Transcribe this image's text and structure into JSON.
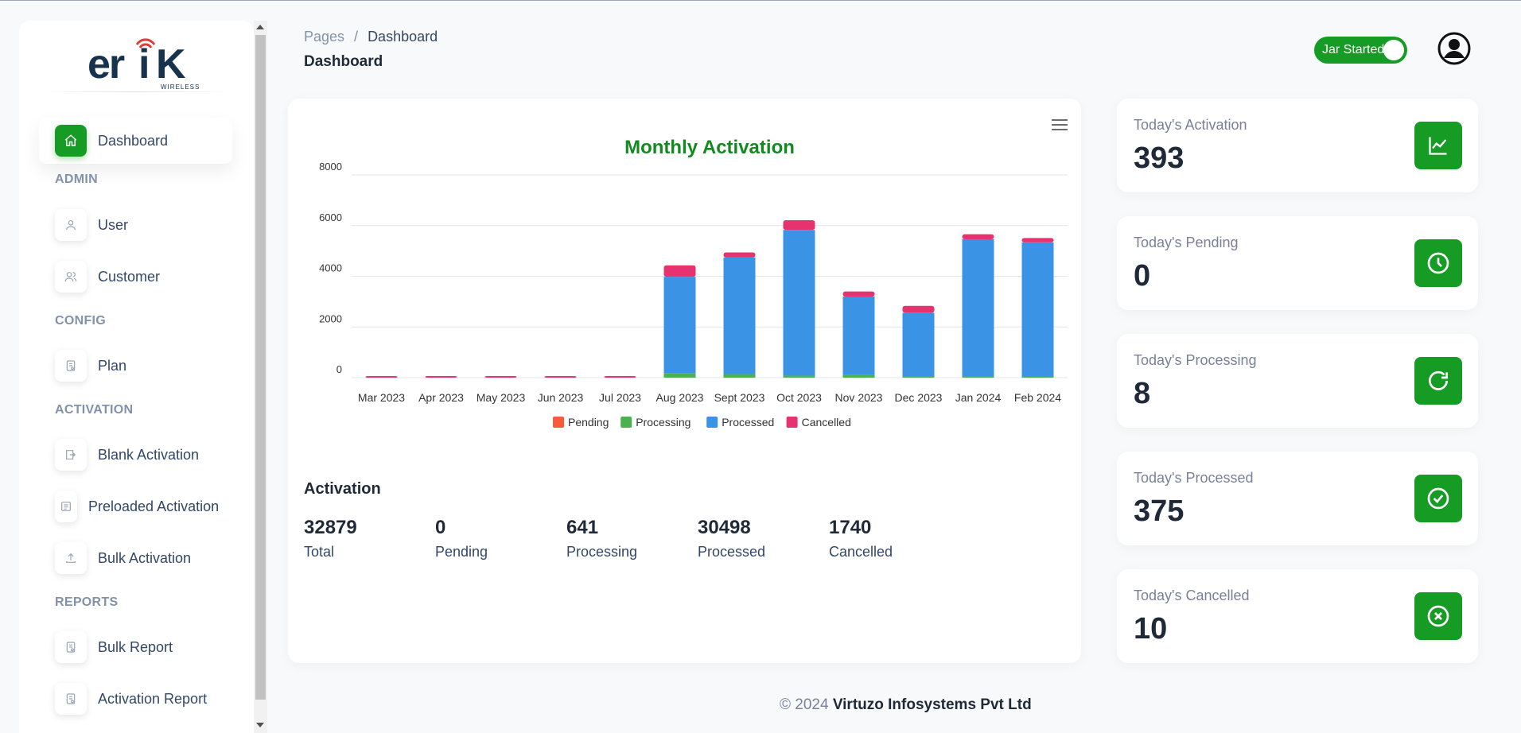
{
  "brand": {
    "logo_text": "erik",
    "logo_sub": "WIRELESS",
    "accent": "#169c25"
  },
  "sidebar": {
    "items": [
      {
        "label": "Dashboard",
        "icon": "home-icon",
        "active": true
      },
      {
        "label": "User",
        "icon": "user-icon"
      },
      {
        "label": "Customer",
        "icon": "users-icon"
      },
      {
        "label": "Plan",
        "icon": "document-icon"
      },
      {
        "label": "Blank Activation",
        "icon": "sim-icon"
      },
      {
        "label": "Preloaded Activation",
        "icon": "preloaded-icon"
      },
      {
        "label": "Bulk Activation",
        "icon": "upload-icon"
      },
      {
        "label": "Bulk Report",
        "icon": "report-icon"
      },
      {
        "label": "Activation Report",
        "icon": "report-icon"
      }
    ],
    "sections": {
      "admin": "ADMIN",
      "config": "CONFIG",
      "activation": "ACTIVATION",
      "reports": "REPORTS"
    }
  },
  "header": {
    "breadcrumb_root": "Pages",
    "breadcrumb_sep": "/",
    "breadcrumb_current": "Dashboard",
    "title": "Dashboard",
    "toggle_label": "Jar Started",
    "toggle_on": true
  },
  "chart_data": {
    "type": "bar",
    "stacked": true,
    "title": "Monthly Activation",
    "title_color": "#138a1f",
    "categories": [
      "Mar 2023",
      "Apr 2023",
      "May 2023",
      "Jun 2023",
      "Jul 2023",
      "Aug 2023",
      "Sept 2023",
      "Oct 2023",
      "Nov 2023",
      "Dec 2023",
      "Jan 2024",
      "Feb 2024"
    ],
    "series": [
      {
        "name": "Pending",
        "color": "#fa5a3c",
        "values": [
          0,
          0,
          0,
          0,
          0,
          0,
          0,
          0,
          0,
          0,
          0,
          0
        ]
      },
      {
        "name": "Processing",
        "color": "#4caf50",
        "values": [
          0,
          0,
          0,
          0,
          0,
          180,
          140,
          80,
          100,
          60,
          60,
          40
        ]
      },
      {
        "name": "Processed",
        "color": "#3b93e6",
        "values": [
          0,
          0,
          0,
          0,
          0,
          3800,
          4600,
          5750,
          3100,
          2500,
          5400,
          5300
        ]
      },
      {
        "name": "Cancelled",
        "color": "#e6336f",
        "values": [
          40,
          40,
          40,
          40,
          40,
          450,
          200,
          380,
          200,
          270,
          200,
          170
        ]
      }
    ],
    "ylim": [
      0,
      8000
    ],
    "yticks": [
      0,
      2000,
      4000,
      6000,
      8000
    ],
    "grid": true,
    "legend": "bottom"
  },
  "activation": {
    "title": "Activation",
    "stats": [
      {
        "value": "32879",
        "label": "Total"
      },
      {
        "value": "0",
        "label": "Pending"
      },
      {
        "value": "641",
        "label": "Processing"
      },
      {
        "value": "30498",
        "label": "Processed"
      },
      {
        "value": "1740",
        "label": "Cancelled"
      }
    ]
  },
  "today": [
    {
      "label": "Today's Activation",
      "value": "393",
      "icon": "chart-line-icon"
    },
    {
      "label": "Today's Pending",
      "value": "0",
      "icon": "clock-icon"
    },
    {
      "label": "Today's Processing",
      "value": "8",
      "icon": "refresh-icon"
    },
    {
      "label": "Today's Processed",
      "value": "375",
      "icon": "check-circle-icon"
    },
    {
      "label": "Today's Cancelled",
      "value": "10",
      "icon": "x-circle-icon"
    }
  ],
  "footer": {
    "copyright": "© 2024",
    "company": "Virtuzo Infosystems Pvt Ltd"
  }
}
